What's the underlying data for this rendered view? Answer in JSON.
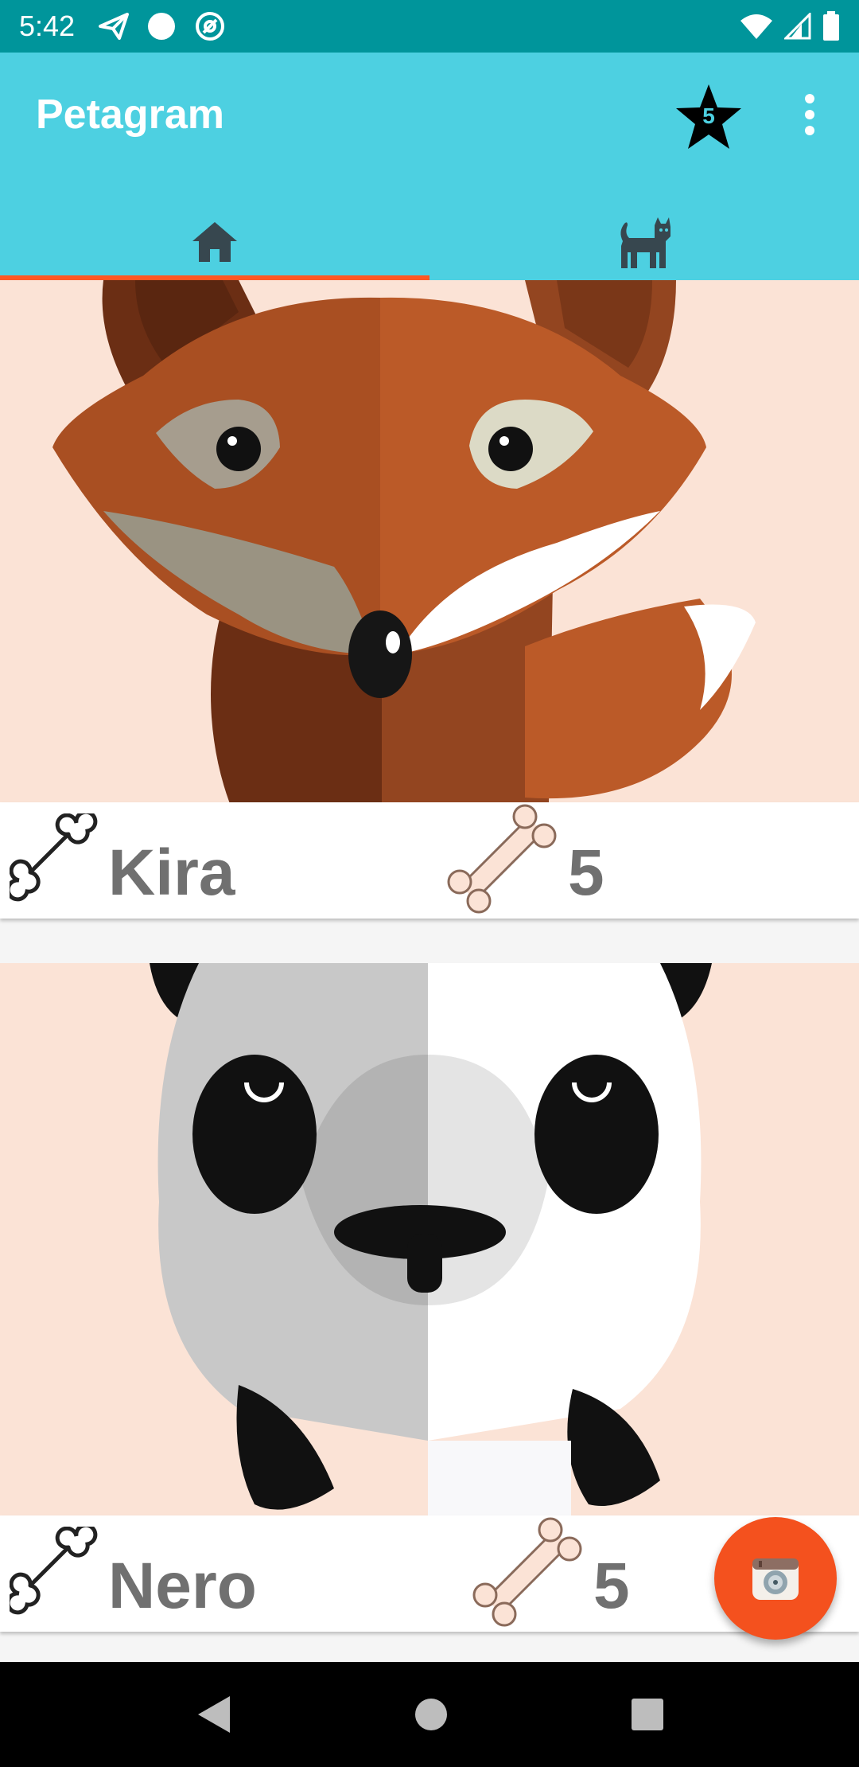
{
  "status_bar": {
    "time": "5:42",
    "left_icons": [
      "send-icon",
      "circle-icon",
      "at-sign-icon"
    ],
    "right_icons": [
      "wifi-icon",
      "signal-icon",
      "battery-icon"
    ]
  },
  "app_bar": {
    "title": "Petagram",
    "favorites_badge": "5",
    "background_color": "#4dd0e1",
    "accent_color": "#ff5722"
  },
  "tabs": [
    {
      "icon": "home-icon",
      "selected": true
    },
    {
      "icon": "cat-icon",
      "selected": false
    }
  ],
  "pets": [
    {
      "name": "Kira",
      "likes": "5",
      "image": "fox-illustration"
    },
    {
      "name": "Nero",
      "likes": "5",
      "image": "panda-illustration"
    }
  ],
  "fab": {
    "icon": "camera-icon",
    "color": "#f4511e"
  },
  "nav_bar": {
    "buttons": [
      "back-icon",
      "home-circle-icon",
      "recents-icon"
    ]
  }
}
